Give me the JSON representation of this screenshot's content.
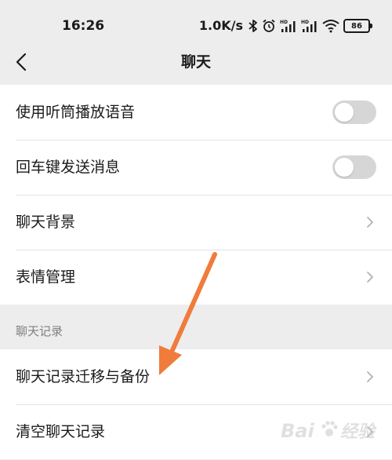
{
  "status_bar": {
    "time": "16:26",
    "network_speed": "1.0K/s",
    "battery": "86",
    "icons": [
      "bluetooth-icon",
      "alarm-icon",
      "hd-signal-icon",
      "hd-signal-icon",
      "wifi-icon",
      "battery-icon"
    ]
  },
  "header": {
    "title": "聊天",
    "back_icon": "chevron-left-icon"
  },
  "settings": {
    "use_earpiece": {
      "label": "使用听筒播放语音",
      "enabled": false
    },
    "enter_to_send": {
      "label": "回车键发送消息",
      "enabled": false
    },
    "chat_background": {
      "label": "聊天背景"
    },
    "sticker_management": {
      "label": "表情管理"
    }
  },
  "chat_history": {
    "section_label": "聊天记录",
    "migrate_backup": {
      "label": "聊天记录迁移与备份"
    },
    "clear_history": {
      "label": "清空聊天记录"
    }
  },
  "watermark": {
    "text": "Bai du 经验"
  },
  "colors": {
    "background": "#ededed",
    "row_background": "#ffffff",
    "toggle_off": "#d6d6d6",
    "annotation_arrow": "#f07c3c",
    "section_text": "#7f7f7f"
  }
}
